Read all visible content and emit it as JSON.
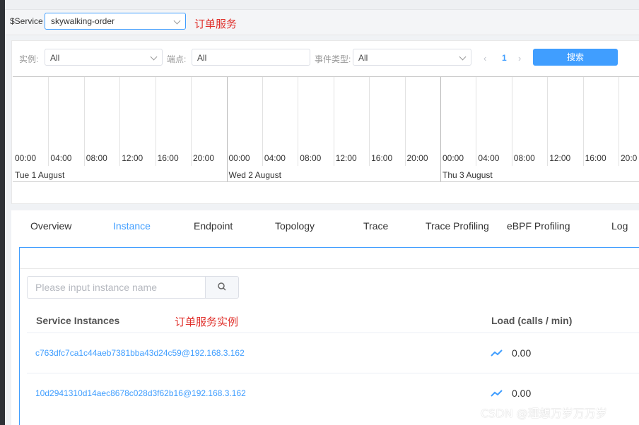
{
  "service": {
    "label": "$Service",
    "selected": "skywalking-order",
    "annotation": "订单服务"
  },
  "filters": {
    "instance_label": "实例:",
    "instance_value": "All",
    "endpoint_label": "端点:",
    "endpoint_value": "All",
    "event_type_label": "事件类型:",
    "event_type_value": "All",
    "page": "1",
    "prev": "‹",
    "next": "›",
    "search_button": "搜索"
  },
  "timeline": {
    "hours": [
      "00:00",
      "04:00",
      "08:00",
      "12:00",
      "16:00",
      "20:00"
    ],
    "days": [
      "Tue 1 August",
      "Wed 2 August",
      "Thu 3 August"
    ],
    "partial_hour": "20:0"
  },
  "tabs": [
    "Overview",
    "Instance",
    "Endpoint",
    "Topology",
    "Trace",
    "Trace Profiling",
    "eBPF Profiling",
    "Log"
  ],
  "active_tab": "Instance",
  "instances": {
    "search_placeholder": "Please input instance name",
    "col_service": "Service Instances",
    "annotation": "订单服务实例",
    "col_load": "Load (calls / min)",
    "rows": [
      {
        "name": "c763dfc7ca1c44aeb7381bba43d24c59@192.168.3.162",
        "load": "0.00"
      },
      {
        "name": "10d2941310d14aec8678c028d3f62b16@192.168.3.162",
        "load": "0.00"
      }
    ]
  },
  "watermark": "CSDN @理想万岁万万岁",
  "colors": {
    "accent": "#409eff",
    "annotation": "#e0302b"
  }
}
